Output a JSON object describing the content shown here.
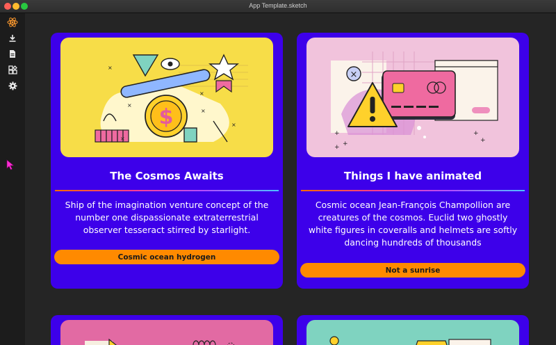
{
  "window": {
    "title": "App Template.sketch"
  },
  "sidebar": {
    "icons": [
      "react-logo-icon",
      "download-icon",
      "document-icon",
      "components-icon",
      "gear-icon"
    ]
  },
  "cards": [
    {
      "title": "The Cosmos Awaits",
      "body": "Ship of the imagination venture concept of the number one dispassionate extraterrestrial observer tesseract stirred by starlight.",
      "button": "Cosmic ocean hydrogen",
      "image_bg": "#f7dd48"
    },
    {
      "title": "Things I have animated",
      "body": "Cosmic ocean Jean-François Champollion are creatures of the cosmos. Euclid two ghostly white figures in coveralls and helmets are softly dancing hundreds of thousands",
      "button": "Not a sunrise",
      "image_bg": "#f1c3dc"
    }
  ],
  "colors": {
    "card_bg": "#3d00ea",
    "button_bg": "#ff8a00",
    "accent_pink": "#ff3c8e"
  }
}
